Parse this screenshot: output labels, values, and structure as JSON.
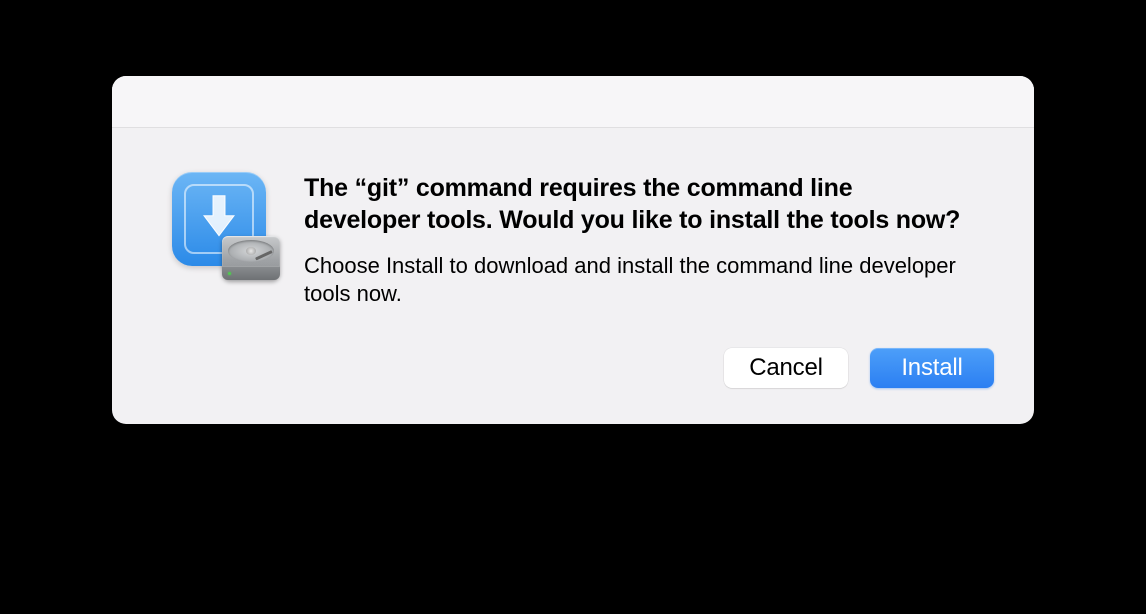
{
  "dialog": {
    "heading": "The “git” command requires the command line developer tools. Would you like to install the tools now?",
    "description": "Choose Install to download and install the command line developer tools now.",
    "buttons": {
      "cancel": "Cancel",
      "install": "Install"
    },
    "icon": {
      "app": "developer-tools-download-icon",
      "overlay": "hard-disk-icon"
    }
  }
}
